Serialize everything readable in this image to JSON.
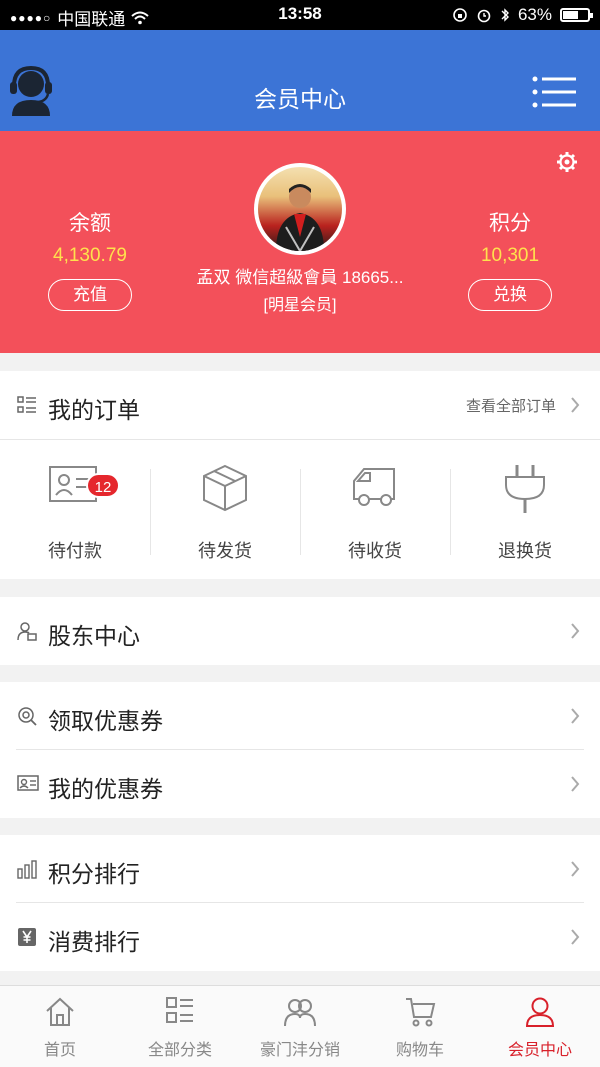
{
  "status_bar": {
    "carrier": "中国联通",
    "time": "13:58",
    "battery": "63%",
    "battery_level": 0.63
  },
  "header": {
    "title": "会员中心",
    "left_icon": "customer-service-icon",
    "right_icon": "menu-icon"
  },
  "profile": {
    "balance_label": "余额",
    "balance_value": "4,130.79",
    "recharge_button": "充值",
    "points_label": "积分",
    "points_value": "10,301",
    "exchange_button": "兑换",
    "name": "孟双 微信超級會員 18665...",
    "level": "[明星会员]",
    "settings_icon": "gear-icon"
  },
  "orders": {
    "title": "我的订单",
    "view_all": "查看全部订单",
    "items": [
      {
        "label": "待付款",
        "icon": "pending-payment-icon",
        "badge": "12"
      },
      {
        "label": "待发货",
        "icon": "box-icon"
      },
      {
        "label": "待收货",
        "icon": "truck-icon"
      },
      {
        "label": "退换货",
        "icon": "plug-icon"
      }
    ]
  },
  "menu": {
    "shareholder": "股东中心",
    "get_coupons": "领取优惠券",
    "my_coupons": "我的优惠券",
    "points_rank": "积分排行",
    "consume_rank": "消费排行"
  },
  "tabbar": {
    "items": [
      {
        "label": "首页",
        "icon": "home-icon"
      },
      {
        "label": "全部分类",
        "icon": "category-icon"
      },
      {
        "label": "豪门沣分销",
        "icon": "distribution-icon"
      },
      {
        "label": "购物车",
        "icon": "cart-icon"
      },
      {
        "label": "会员中心",
        "icon": "user-icon",
        "active": true
      }
    ]
  },
  "colors": {
    "header_bg": "#3c74d6",
    "profile_bg": "#f3505a",
    "accent_value": "#ffe14d",
    "active_tab": "#d8202a"
  }
}
